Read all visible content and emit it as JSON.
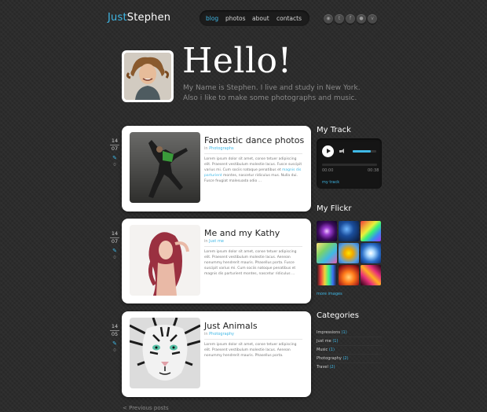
{
  "site": {
    "logo_part1": "Just",
    "logo_part2": "Stephen"
  },
  "nav": [
    {
      "label": "blog",
      "active": true
    },
    {
      "label": "photos",
      "active": false
    },
    {
      "label": "about",
      "active": false
    },
    {
      "label": "contacts",
      "active": false
    }
  ],
  "social": [
    "rss-icon",
    "twitter-icon",
    "facebook-icon",
    "flickr-icon",
    "vimeo-icon"
  ],
  "hero": {
    "title": "Hello!",
    "intro_line1": "My Name is Stephen. I live and study in New York.",
    "intro_line2": "Also i like to make some photographs and music."
  },
  "posts": [
    {
      "day": "14",
      "month": "07",
      "comments": "0",
      "title": "Fantastic dance photos",
      "category_prefix": "in ",
      "category": "Photographs",
      "excerpt_a": "Lorem ipsum dolor sit amet, conse tetuer adipiscing elit. Praesent vestibulum molestie lacus. Fusce suscipit varius mi. Cum sociis natoque penatibus et ",
      "excerpt_link": "magnis dis parturient",
      "excerpt_b": " montes, nascetur ridiculus mus. Nulla dui. Fusce feugiat malesuada odio ..."
    },
    {
      "day": "14",
      "month": "07",
      "comments": "0",
      "title": "Me and my Kathy",
      "category_prefix": "in ",
      "category": "Just me",
      "excerpt_a": "Lorem ipsum dolor sit amet, conse tetuer adipiscing elit. Praesent vestibulum molestie lacus. Aenean nonummy hendrerit mauris. Phasellus porta. Fusce suscipit varius mi. Cum sociis natoque penatibus et magnis dis parturient montes, nascetur ridiculus ...",
      "excerpt_link": "",
      "excerpt_b": ""
    },
    {
      "day": "14",
      "month": "05",
      "comments": "0",
      "title": "Just Animals",
      "category_prefix": "in ",
      "category": "Photography",
      "excerpt_a": "Lorem ipsum dolor sit amet, conse tetuer adipiscing elit. Praesent vestibulum molestie lacus. Aenean nonummy hendrerit mauris. Phasellus porta.",
      "excerpt_link": "",
      "excerpt_b": ""
    }
  ],
  "pagination": {
    "prev": "< Previous posts"
  },
  "sidebar": {
    "track_title": "My Track",
    "track_time_start": "00:00",
    "track_time_end": "00:38",
    "track_link": "my track",
    "track_volume": 0.75,
    "track_progress": 0.0,
    "flickr_title": "My Flickr",
    "more_images": "more images",
    "flickr_thumbs": [
      {
        "name": "flickr-thumb-purple-burst",
        "bg": "radial-gradient(circle at 50% 50%, #f0c8ff 0%, #9b3dd0 25%, #3a0a5a 60%, #0e0620 100%)"
      },
      {
        "name": "flickr-thumb-blue-space",
        "bg": "radial-gradient(circle at 40% 40%, #6fb6ff 0%, #1a4d9c 40%, #0a1836 100%)"
      },
      {
        "name": "flickr-thumb-rainbow-rays",
        "bg": "linear-gradient(135deg, #f23a3a 0%, #f2b33a 25%, #e8f23a 40%, #3af27a 55%, #3a8cf2 75%, #a03af2 100%)"
      },
      {
        "name": "flickr-thumb-colorful-shapes",
        "bg": "linear-gradient(135deg, #ffe27a 0%, #7ad36b 35%, #3fb8e6 65%, #e85ab0 100%)"
      },
      {
        "name": "flickr-thumb-yellow-flower",
        "bg": "radial-gradient(circle at 50% 50%, #ffe600 0%, #f0a800 30%, #5aa0e0 70%, #2c6fc0 100%)"
      },
      {
        "name": "flickr-thumb-blue-swirl",
        "bg": "radial-gradient(circle at 50% 50%, #ffffff 0%, #a9d8ff 25%, #2a6ec8 60%, #0c2a66 100%)"
      },
      {
        "name": "flickr-thumb-rainbow-wave",
        "bg": "linear-gradient(90deg, #1b1b1b 0%, #e83a3a 20%, #f2d23a 40%, #3af28a 60%, #3a6ef2 80%, #1b1b1b 100%)"
      },
      {
        "name": "flickr-thumb-orange-glow",
        "bg": "radial-gradient(circle at 50% 60%, #ffd47a 0%, #ff7a1a 35%, #a01a1a 75%, #2a0606 100%)"
      },
      {
        "name": "flickr-thumb-light-trails",
        "bg": "linear-gradient(45deg, #200010 0%, #e8307a 30%, #ffb020 50%, #e8307a 70%, #200010 100%)"
      }
    ],
    "categories_title": "Categories",
    "categories": [
      {
        "name": "Impressions",
        "count": "(1)"
      },
      {
        "name": "Just me",
        "count": "(1)"
      },
      {
        "name": "Music",
        "count": "(1)"
      },
      {
        "name": "Photography",
        "count": "(2)"
      },
      {
        "name": "Travel",
        "count": "(2)"
      }
    ]
  },
  "colors": {
    "accent": "#3fb8e6",
    "background": "#2a2a2a",
    "card": "#ffffff"
  }
}
